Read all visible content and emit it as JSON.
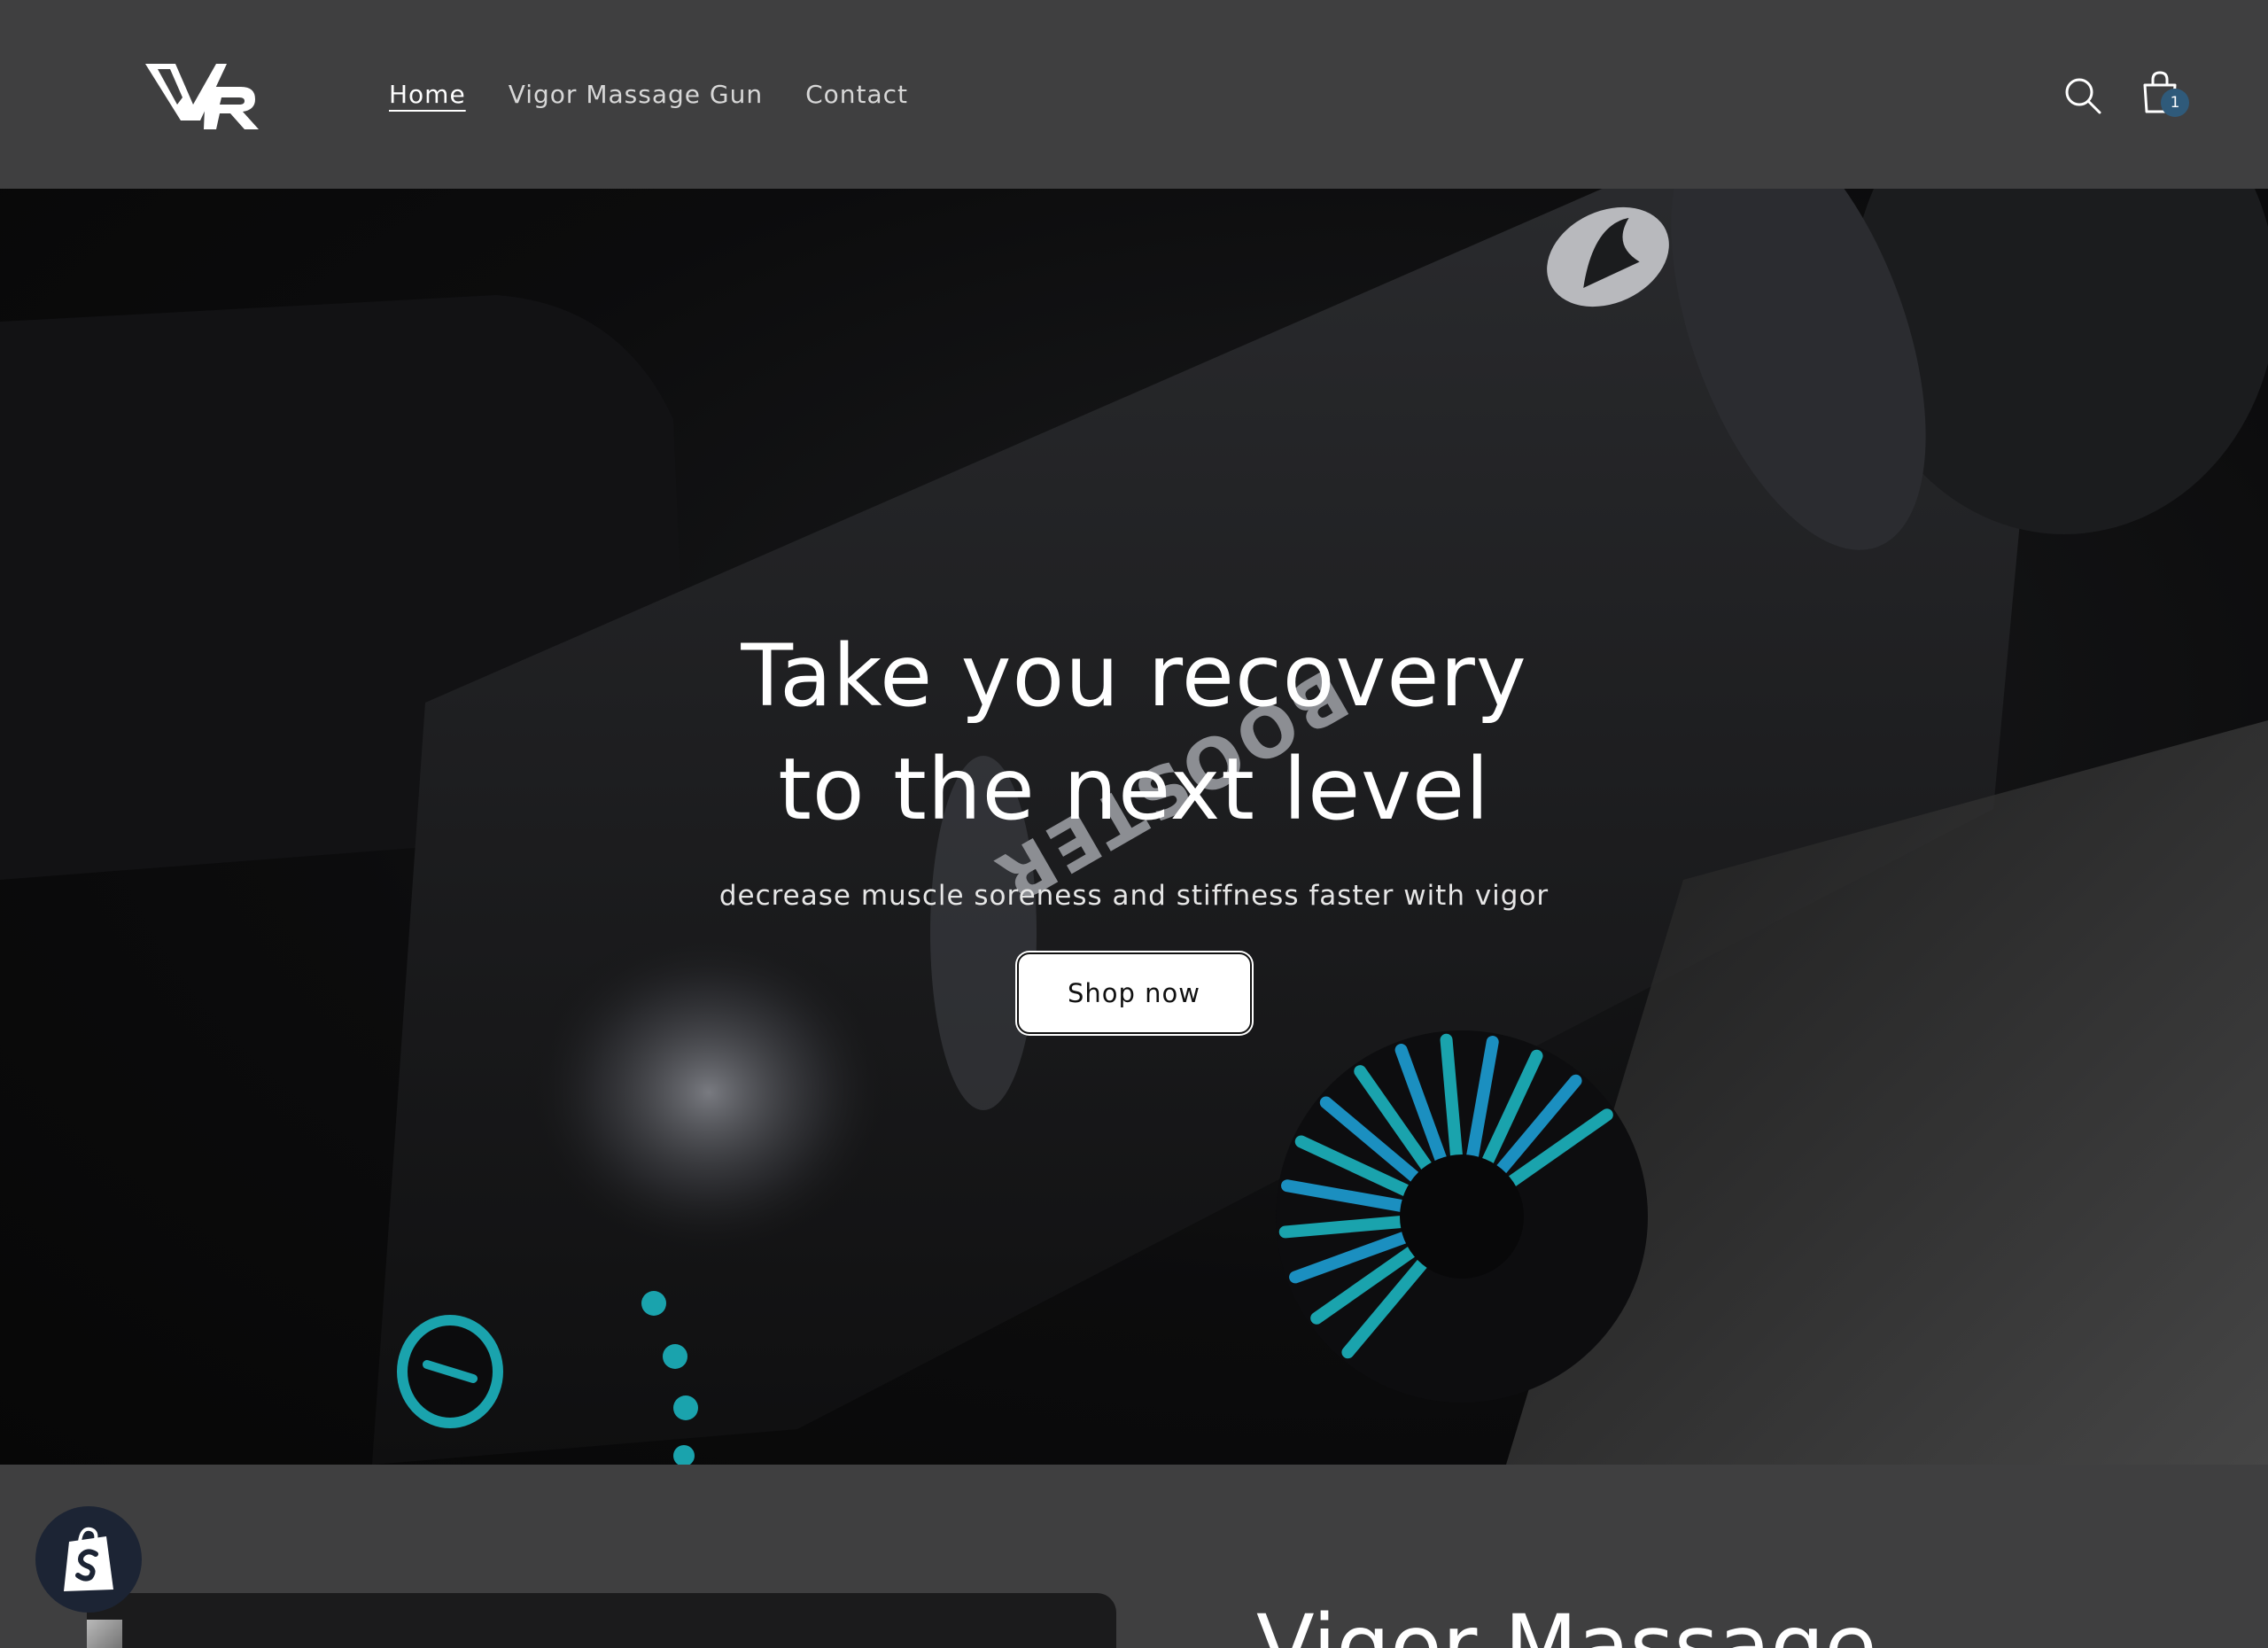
{
  "header": {
    "logo_text": "VR",
    "nav": [
      {
        "label": "Home",
        "active": true
      },
      {
        "label": "Vigor Massage Gun",
        "active": false
      },
      {
        "label": "Contact",
        "active": false
      }
    ],
    "search_icon": "search-icon",
    "cart_icon": "cart-icon",
    "cart_count": "1"
  },
  "hero": {
    "title": "Take you recovery to the next level",
    "subtitle": "decrease muscle soreness and stiffness faster with vigor",
    "button_label": "Shop now",
    "product_brand_text": "BOOSTER"
  },
  "product": {
    "title": "Vigor Massage"
  },
  "shopify_badge_icon": "shopify-bag-icon",
  "colors": {
    "header_bg": "#3f3f40",
    "accent_teal": "#1aa3ad",
    "cart_badge": "#2f5a7a"
  }
}
